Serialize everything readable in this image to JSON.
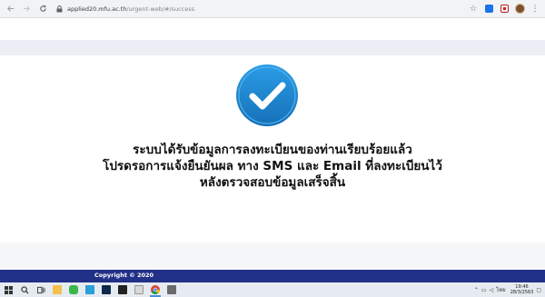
{
  "browser": {
    "url_host": "applied20.mfu.ac.th",
    "url_path": "/urgent-web/#/success"
  },
  "message": {
    "line1": "ระบบได้รับข้อมูลการลงทะเบียนของท่านเรียบร้อยแล้ว",
    "line2": "โปรดรอการแจ้งยืนยันผล ทาง SMS และ Email ที่ลงทะเบียนไว้",
    "line3": "หลังตรวจสอบข้อมูลเสร็จสิ้น"
  },
  "footer": {
    "copyright": "Copyright © 2020"
  },
  "taskbar": {
    "language": "ไทย",
    "time": "19:46",
    "date": "28/3/2563"
  },
  "colors": {
    "check_outer": "#1b7fc8",
    "check_inner": "#1e8fdc",
    "footer_bg": "#223188",
    "strip_bg": "#eceef5"
  }
}
